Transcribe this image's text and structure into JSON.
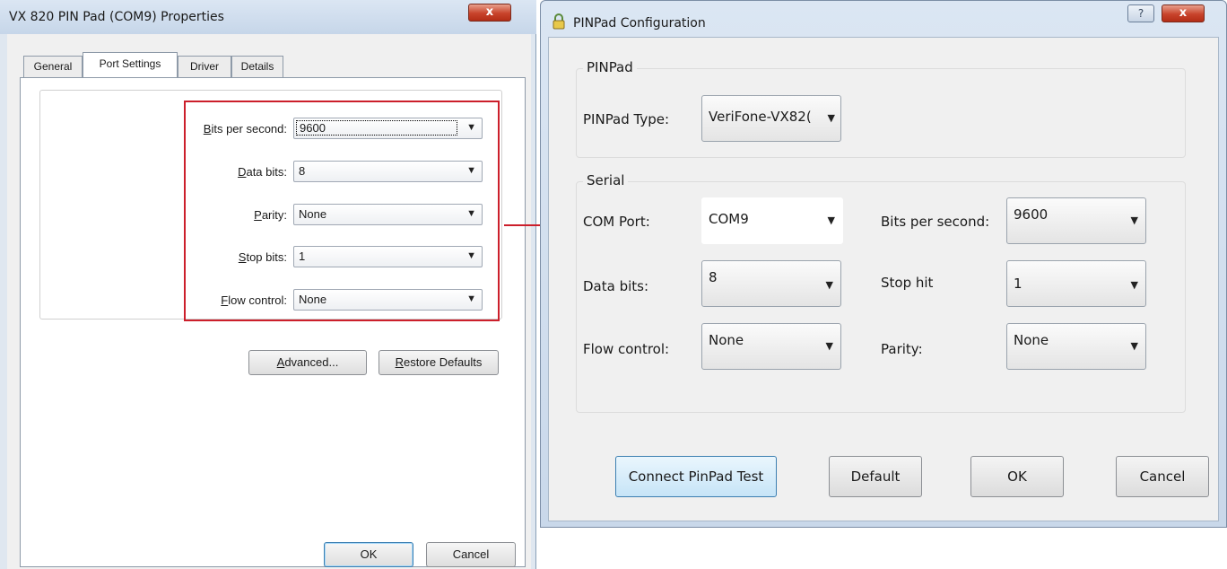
{
  "left_window": {
    "title": "VX 820 PIN Pad (COM9) Properties",
    "close_label": "x",
    "tabs": [
      {
        "label": "General"
      },
      {
        "label": "Port Settings",
        "active": true
      },
      {
        "label": "Driver"
      },
      {
        "label": "Details"
      }
    ],
    "fields": {
      "bits_per_second": {
        "mnemonic": "B",
        "label": "its per second:",
        "value": "9600"
      },
      "data_bits": {
        "mnemonic": "D",
        "label": "ata bits:",
        "value": "8"
      },
      "parity": {
        "mnemonic": "P",
        "label": "arity:",
        "value": "None"
      },
      "stop_bits": {
        "mnemonic": "S",
        "label": "top bits:",
        "value": "1"
      },
      "flow_control": {
        "mnemonic": "F",
        "label": "low control:",
        "value": "None"
      }
    },
    "buttons": {
      "advanced": {
        "mnemonic": "A",
        "rest": "dvanced..."
      },
      "restore_defaults": {
        "mnemonic": "R",
        "rest": "estore Defaults"
      },
      "ok": "OK",
      "cancel": "Cancel"
    }
  },
  "right_window": {
    "title": "PINPad Configuration",
    "help_label": "?",
    "close_label": "x",
    "pinpad_group": {
      "title": "PINPad",
      "type_label": "PINPad Type:",
      "type_value": "VeriFone-VX82("
    },
    "serial_group": {
      "title": "Serial",
      "com_port_label": "COM Port:",
      "com_port_value": "COM9",
      "bits_label": "Bits per second:",
      "bits_value": "9600",
      "data_bits_label": "Data bits:",
      "data_bits_value": "8",
      "stop_label": "Stop hit",
      "stop_value": "1",
      "flow_label": "Flow control:",
      "flow_value": "None",
      "parity_label": "Parity:",
      "parity_value": "None"
    },
    "buttons": {
      "connect": "Connect PinPad Test",
      "default": "Default",
      "ok": "OK",
      "cancel": "Cancel"
    }
  },
  "colors": {
    "highlight_box": "#cc1f2b",
    "arrow": "#cc1f2b",
    "close_button": "#c8432b"
  },
  "icons": {
    "dropdown": "chevron-down-icon",
    "title_icon": "lock-icon",
    "arrow": "arrow-right-icon"
  }
}
